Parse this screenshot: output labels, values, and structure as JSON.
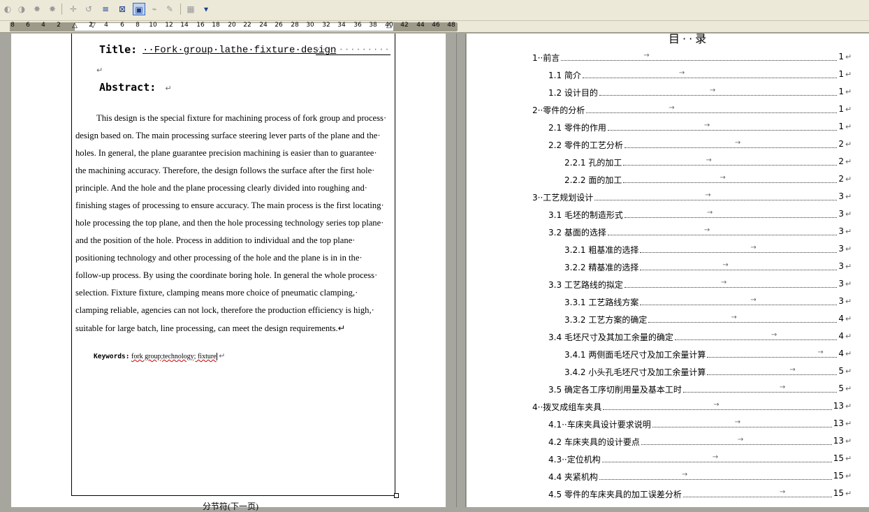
{
  "toolbar": {
    "buttons": [
      {
        "name": "tool-back-icon",
        "glyph": "◐",
        "active": false
      },
      {
        "name": "tool-forward-icon",
        "glyph": "◑",
        "active": false
      },
      {
        "name": "tool-star1-icon",
        "glyph": "✸",
        "active": false
      },
      {
        "name": "tool-star2-icon",
        "glyph": "✸",
        "active": false
      },
      {
        "name": "tool-crosshair-icon",
        "glyph": "✛",
        "active": false
      },
      {
        "name": "tool-reset-icon",
        "glyph": "↺",
        "active": false
      },
      {
        "name": "tool-lines-icon",
        "glyph": "≡",
        "active": true
      },
      {
        "name": "tool-crop-icon",
        "glyph": "⊠",
        "active": true
      },
      {
        "name": "tool-format-picture-icon",
        "glyph": "▣",
        "active": true
      },
      {
        "name": "tool-transparency-icon",
        "glyph": "⌁",
        "active": false
      },
      {
        "name": "tool-pencil-icon",
        "glyph": "✎",
        "active": false
      },
      {
        "name": "tool-wrap-icon",
        "glyph": "▦",
        "active": false
      },
      {
        "name": "tool-more-icon",
        "glyph": "▾",
        "active": true
      }
    ]
  },
  "ruler": {
    "numbers": [
      "8",
      "6",
      "4",
      "2",
      "2",
      "4",
      "6",
      "8",
      "10",
      "12",
      "14",
      "16",
      "18",
      "20",
      "22",
      "24",
      "26",
      "28",
      "30",
      "32",
      "34",
      "36",
      "38",
      "40",
      "42",
      "44",
      "46",
      "48"
    ]
  },
  "left_page": {
    "title_label": "Title:",
    "title_text": "··Fork·group·lathe·fixture·design",
    "title_dots": "·············",
    "para_mark": "↵",
    "abstract_label": "Abstract:",
    "abstract_lines": [
      "This design is the special fixture for machining process of fork group and process·",
      "design based on. The main processing surface steering lever parts of the plane and the·",
      "holes. In general, the plane guarantee precision machining is easier than to guarantee·",
      "the machining accuracy. Therefore, the design follows the surface after the first hole·",
      "principle. And the hole and the plane processing clearly divided into roughing and·",
      "finishing stages of processing to ensure accuracy. The main process is the first locating·",
      "hole processing the top plane, and then the hole processing technology series top plane·",
      "and the position of the hole. Process in addition to individual and the top plane·",
      "positioning technology and other processing of the hole and the plane is in in the·",
      "follow-up process. By using the coordinate boring hole. In general the whole process·",
      "selection. Fixture fixture, clamping means more choice of pneumatic clamping,·",
      "clamping reliable, agencies can not lock, therefore the production efficiency is high,·",
      "suitable for large batch, line processing, can meet the design requirements.↵"
    ],
    "keywords_label": "Keywords:",
    "keywords_value": "fork group;technology; fixture",
    "footer": "分节符(下一页)"
  },
  "toc": {
    "heading": "目··录",
    "entries": [
      {
        "label": "1··前言",
        "page": "1",
        "level": 0
      },
      {
        "label": "1.1 简介",
        "page": "1",
        "level": 1
      },
      {
        "label": "1.2 设计目的",
        "page": "1",
        "level": 1
      },
      {
        "label": "2··零件的分析",
        "page": "1",
        "level": 0
      },
      {
        "label": "2.1 零件的作用",
        "page": "1",
        "level": 1
      },
      {
        "label": "2.2 零件的工艺分析",
        "page": "2",
        "level": 1
      },
      {
        "label": "2.2.1 孔的加工",
        "page": "2",
        "level": 2
      },
      {
        "label": "2.2.2 面的加工",
        "page": "2",
        "level": 2
      },
      {
        "label": "3··工艺规划设计",
        "page": "3",
        "level": 0
      },
      {
        "label": "3.1 毛坯的制造形式",
        "page": "3",
        "level": 1
      },
      {
        "label": "3.2 基面的选择",
        "page": "3",
        "level": 1
      },
      {
        "label": "3.2.1 粗基准的选择",
        "page": "3",
        "level": 2
      },
      {
        "label": "3.2.2 精基准的选择",
        "page": "3",
        "level": 2
      },
      {
        "label": "3.3 工艺路线的拟定",
        "page": "3",
        "level": 1
      },
      {
        "label": "3.3.1 工艺路线方案",
        "page": "3",
        "level": 2
      },
      {
        "label": "3.3.2 工艺方案的确定",
        "page": "4",
        "level": 2
      },
      {
        "label": "3.4 毛坯尺寸及其加工余量的确定",
        "page": "4",
        "level": 1
      },
      {
        "label": "3.4.1 两侧面毛坯尺寸及加工余量计算",
        "page": "4",
        "level": 2
      },
      {
        "label": "3.4.2 小头孔毛坯尺寸及加工余量计算",
        "page": "5",
        "level": 2
      },
      {
        "label": "3.5 确定各工序切削用量及基本工时",
        "page": "5",
        "level": 1
      },
      {
        "label": "4··拨叉成组车夹具",
        "page": "13",
        "level": 0
      },
      {
        "label": "4.1··车床夹具设计要求说明",
        "page": "13",
        "level": 1
      },
      {
        "label": "4.2 车床夹具的设计要点",
        "page": "13",
        "level": 1
      },
      {
        "label": "4.3··定位机构",
        "page": "15",
        "level": 1
      },
      {
        "label": "4.4 夹紧机构",
        "page": "15",
        "level": 1
      },
      {
        "label": "4.5 零件的车床夹具的加工误差分析",
        "page": "15",
        "level": 1
      }
    ]
  }
}
